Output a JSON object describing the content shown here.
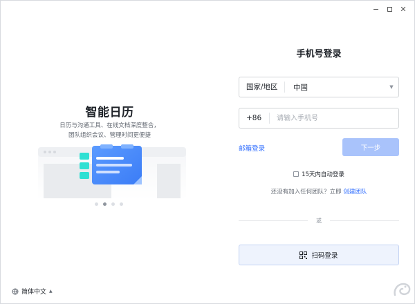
{
  "window": {
    "controls": {
      "minimize": "minimize",
      "maximize": "maximize",
      "close": "✕"
    }
  },
  "promo": {
    "title": "智能日历",
    "desc_line1": "日历与沟通工具、在线文档深度整合，",
    "desc_line2": "团队组织会议、管理时间更便捷",
    "carousel": {
      "count": 4,
      "active_index": 1
    }
  },
  "language": {
    "label": "简体中文"
  },
  "login": {
    "title": "手机号登录",
    "region": {
      "label": "国家/地区",
      "value": "中国"
    },
    "phone": {
      "code": "+86",
      "placeholder": "请输入手机号",
      "value": ""
    },
    "email_login": "邮箱登录",
    "next_button": "下一步",
    "auto_login": "15天内自动登录",
    "auto_login_checked": false,
    "team_prompt": "还没有加入任何团队？立即",
    "create_team": "创建团队",
    "divider": "或",
    "qr_login": "扫码登录"
  },
  "colors": {
    "accent": "#3370ff",
    "next_disabled": "#a9c3fb",
    "qr_bg": "#eef3fd",
    "illus_blue": "#4d8dfb",
    "illus_teal": "#2fe0d3"
  },
  "icons": {
    "lang": "globe-icon",
    "qr": "qr-code-icon",
    "dropdown": "chevron-down-icon"
  }
}
